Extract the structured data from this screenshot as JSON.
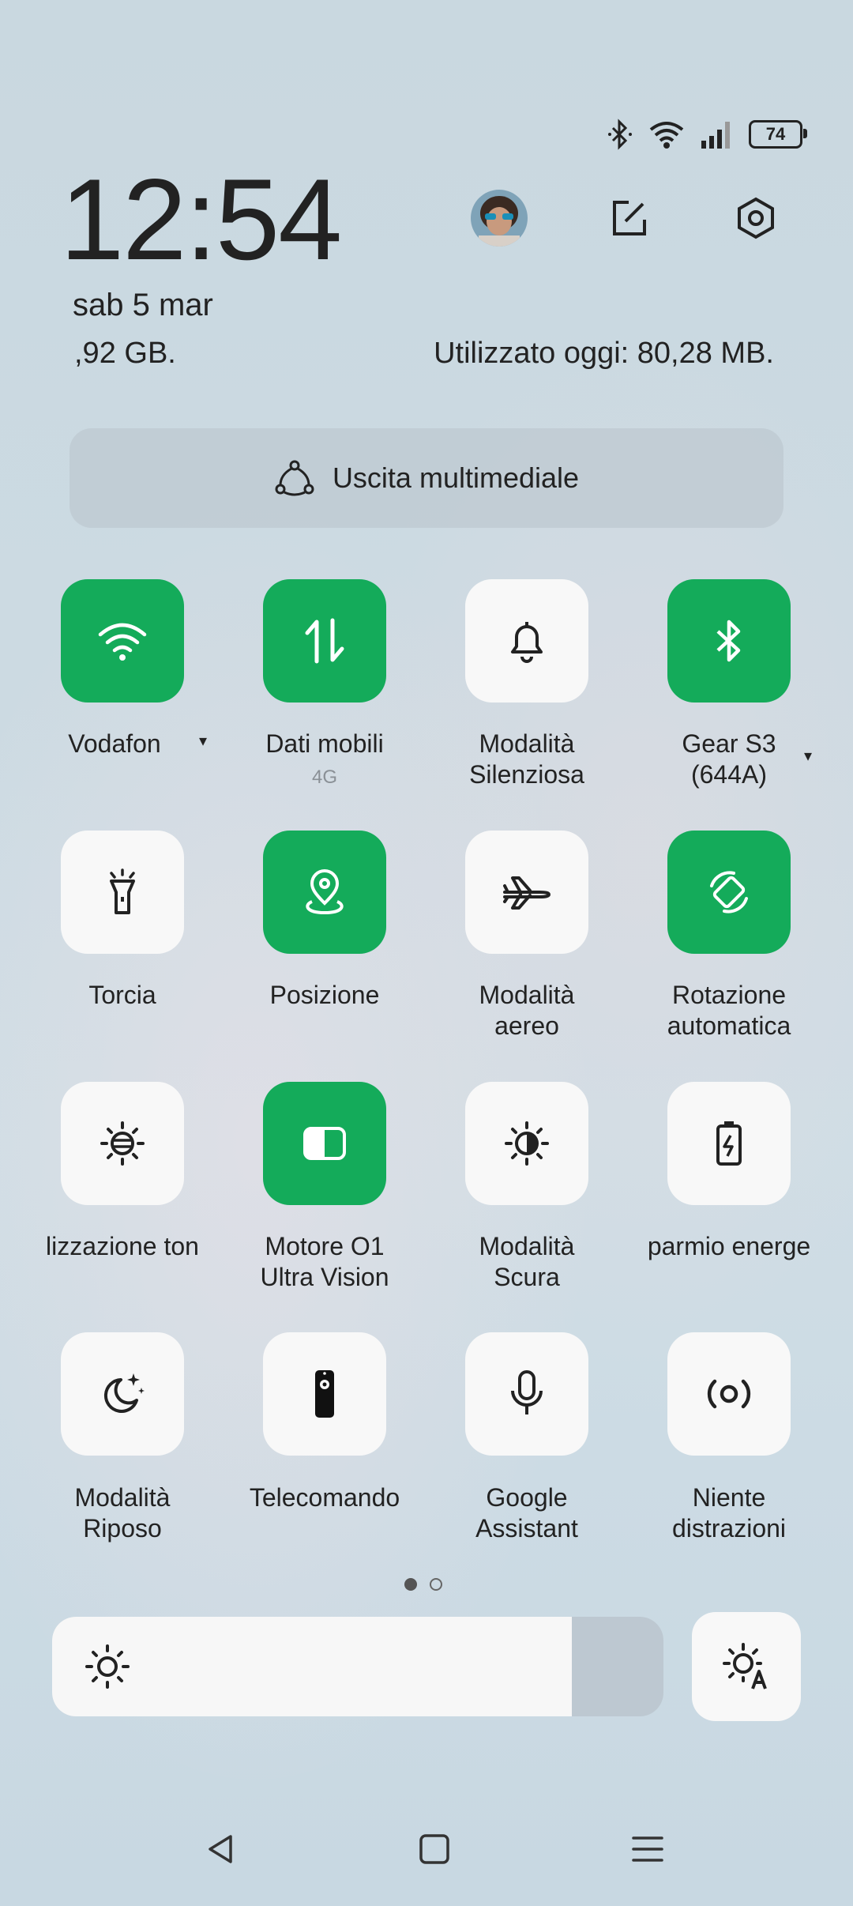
{
  "status_bar": {
    "battery_level": "74",
    "icons": [
      "bluetooth-icon",
      "wifi-icon",
      "signal-icon",
      "battery-icon"
    ]
  },
  "header": {
    "time": "12:54",
    "date": "sab 5 mar",
    "storage_text": ",92 GB.",
    "usage_text": "Utilizzato oggi: 80,28 MB.",
    "icons": [
      "avatar",
      "edit-icon",
      "settings-icon"
    ]
  },
  "media_output": {
    "label": "Uscita multimediale"
  },
  "tiles": [
    {
      "label": "Vodafon",
      "state": "on",
      "icon": "wifi-icon"
    },
    {
      "label": "Dati mobili",
      "sub": "4G",
      "state": "on",
      "icon": "mobile-data-icon"
    },
    {
      "label": "Modalità\nSilenziosa",
      "state": "off",
      "icon": "bell-icon"
    },
    {
      "label": "Gear S3\n(644A)",
      "state": "on",
      "icon": "bluetooth-icon"
    },
    {
      "label": "Torcia",
      "state": "off",
      "icon": "flashlight-icon"
    },
    {
      "label": "Posizione",
      "state": "on",
      "icon": "location-icon"
    },
    {
      "label": "Modalità\naereo",
      "state": "off",
      "icon": "airplane-icon"
    },
    {
      "label": "Rotazione\nautomatica",
      "state": "on",
      "icon": "rotate-icon"
    },
    {
      "label": "lizzazione ton",
      "state": "off",
      "icon": "eye-comfort-icon"
    },
    {
      "label": "Motore O1\nUltra Vision",
      "state": "on",
      "icon": "vision-icon"
    },
    {
      "label": "Modalità\nScura",
      "state": "off",
      "icon": "dark-mode-icon"
    },
    {
      "label": "parmio energe",
      "state": "off",
      "icon": "battery-saver-icon"
    },
    {
      "label": "Modalità\nRiposo",
      "state": "off",
      "icon": "moon-icon"
    },
    {
      "label": "Telecomando",
      "state": "off",
      "icon": "remote-icon"
    },
    {
      "label": "Google\nAssistant",
      "state": "off",
      "icon": "mic-icon"
    },
    {
      "label": "Niente\ndistrazioni",
      "state": "off",
      "icon": "focus-icon"
    }
  ],
  "pager": {
    "pages": 2,
    "current": 1
  },
  "brightness": {
    "level": 0.85
  },
  "colors": {
    "accent": "#14ab5a",
    "tile_off": "#f8f8f8"
  },
  "nav_bar": [
    "back-icon",
    "home-icon",
    "menu-icon"
  ]
}
